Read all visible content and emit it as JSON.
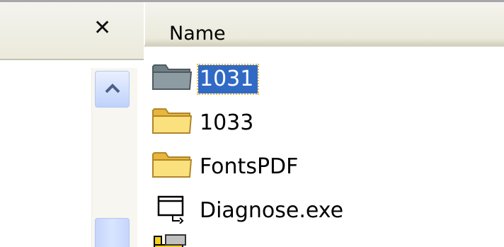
{
  "left_pane": {
    "close_icon": "×",
    "scroll_up_icon": "chevron-up-icon"
  },
  "list": {
    "header": {
      "column_name": "Name"
    },
    "items": [
      {
        "label": "1031",
        "icon": "folder-gray-icon",
        "selected": true
      },
      {
        "label": "1033",
        "icon": "folder-icon",
        "selected": false
      },
      {
        "label": "FontsPDF",
        "icon": "folder-icon",
        "selected": false
      },
      {
        "label": "Diagnose.exe",
        "icon": "exe-window-icon",
        "selected": false
      },
      {
        "label": "",
        "icon": "ruler-file-icon",
        "selected": false
      }
    ]
  },
  "colors": {
    "selection": "#316ac5",
    "selection_focus_border": "#e6b84f",
    "pane_background": "#ece9d8",
    "scrollbar_button": "#c0d2fb"
  }
}
